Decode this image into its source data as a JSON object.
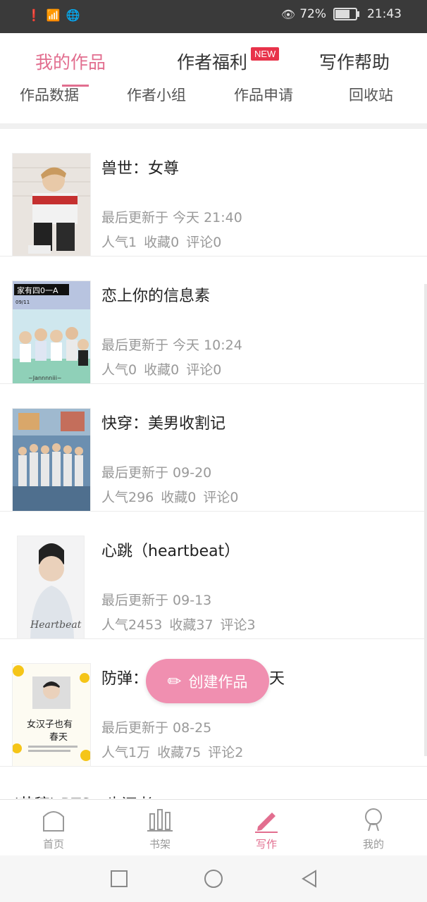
{
  "statusbar": {
    "battery_pct": "72%",
    "battery_level": 0.72,
    "time": "21:43"
  },
  "topnav": {
    "tabs": [
      "我的作品",
      "作者福利",
      "写作帮助"
    ],
    "active_tab": "我的作品",
    "new_badge": "NEW"
  },
  "subnav": {
    "items": [
      "作品数据",
      "作者小组",
      "作品申请",
      "回收站"
    ]
  },
  "works": [
    {
      "title": "兽世：女尊",
      "updated": "最后更新于 今天 21:40",
      "popularity": "人气1",
      "favorites": "收藏0",
      "comments": "评论0"
    },
    {
      "title": "恋上你的信息素",
      "updated": "最后更新于 今天 10:24",
      "popularity": "人气0",
      "favorites": "收藏0",
      "comments": "评论0"
    },
    {
      "title": "快穿：美男收割记",
      "updated": "最后更新于 09-20",
      "popularity": "人气296",
      "favorites": "收藏0",
      "comments": "评论0"
    },
    {
      "title": "心跳（heartbeat）",
      "updated": "最后更新于 09-13",
      "popularity": "人气2453",
      "favorites": "收藏37",
      "comments": "评论3"
    },
    {
      "title": "防弹：",
      "title_tail": "天",
      "updated": "最后更新于 08-25",
      "popularity": "人气1万",
      "favorites": "收藏75",
      "comments": "评论2"
    }
  ],
  "cover_texts": {
    "cover2_banner": "家有四0一A",
    "cover2_date": "09/11",
    "cover2_footer": "~Jannnniii~",
    "cover4_script": "Heartbeat",
    "cover5_line1": "女汉子也有",
    "cover5_line2": "春天"
  },
  "partial_row_text": "(节稿) BTS：也还者",
  "fab": {
    "label": "创建作品"
  },
  "bottomnav": {
    "items": [
      "首页",
      "书架",
      "写作",
      "我的"
    ],
    "active": "写作"
  },
  "colors": {
    "accent": "#e26e8f",
    "fab": "#f08fb0",
    "badge": "#e8334a"
  }
}
